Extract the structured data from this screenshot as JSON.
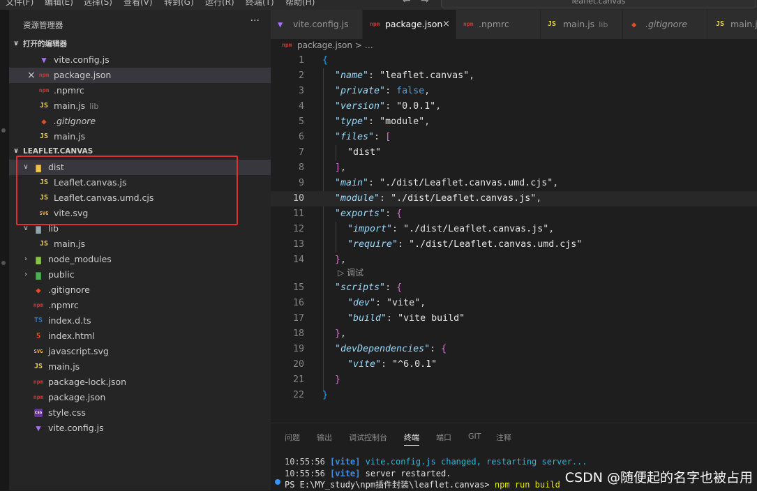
{
  "menubar": {
    "items": [
      "文件(F)",
      "编辑(E)",
      "选择(S)",
      "查看(V)",
      "转到(G)",
      "运行(R)",
      "终端(T)",
      "帮助(H)"
    ],
    "back_arrow": "←",
    "forward_arrow": "→",
    "command_center": "leaflet.canvas"
  },
  "sidebar": {
    "title": "资源管理器",
    "more": "···",
    "open_editors": {
      "header": "打开的编辑器",
      "items": [
        {
          "icon": "vite-icon",
          "glyph": "▼",
          "label": "vite.config.js",
          "detail": ""
        },
        {
          "icon": "npm-icon",
          "glyph": "npm",
          "label": "package.json",
          "detail": "",
          "close": "×"
        },
        {
          "icon": "npm-icon",
          "glyph": "npm",
          "label": ".npmrc",
          "detail": ""
        },
        {
          "icon": "js-icon",
          "glyph": "JS",
          "label": "main.js",
          "detail": "lib"
        },
        {
          "icon": "git-icon",
          "glyph": "◆",
          "label": ".gitignore",
          "detail": ""
        },
        {
          "icon": "js-icon",
          "glyph": "JS",
          "label": "main.js",
          "detail": ""
        }
      ]
    },
    "project": {
      "header": "LEAFLET.CANVAS",
      "items": [
        {
          "type": "folder",
          "label": "dist",
          "glyph": "▆"
        },
        {
          "type": "file",
          "glyph": "JS",
          "label": "Leaflet.canvas.js"
        },
        {
          "type": "file",
          "glyph": "JS",
          "label": "Leaflet.canvas.umd.cjs"
        },
        {
          "type": "file",
          "glyph": "SVG",
          "label": "vite.svg"
        },
        {
          "type": "folder",
          "label": "lib",
          "glyph": "▆"
        },
        {
          "type": "file",
          "glyph": "JS",
          "label": "main.js"
        },
        {
          "type": "folder",
          "label": "node_modules",
          "glyph": "▆"
        },
        {
          "type": "folder",
          "label": "public",
          "glyph": "▆"
        },
        {
          "type": "file",
          "glyph": "◆",
          "label": ".gitignore"
        },
        {
          "type": "file",
          "glyph": "npm",
          "label": ".npmrc"
        },
        {
          "type": "file",
          "glyph": "TS",
          "label": "index.d.ts"
        },
        {
          "type": "file",
          "glyph": "5",
          "label": "index.html"
        },
        {
          "type": "file",
          "glyph": "SVG",
          "label": "javascript.svg"
        },
        {
          "type": "file",
          "glyph": "JS",
          "label": "main.js"
        },
        {
          "type": "file",
          "glyph": "npm",
          "label": "package-lock.json"
        },
        {
          "type": "file",
          "glyph": "npm",
          "label": "package.json"
        },
        {
          "type": "file",
          "glyph": "css",
          "label": "style.css"
        },
        {
          "type": "file",
          "glyph": "▼",
          "label": "vite.config.js"
        }
      ]
    }
  },
  "tabs": [
    {
      "glyph": "▼",
      "label": "vite.config.js",
      "detail": ""
    },
    {
      "glyph": "npm",
      "label": "package.json",
      "detail": "",
      "close": "×"
    },
    {
      "glyph": "npm",
      "label": ".npmrc",
      "detail": ""
    },
    {
      "glyph": "JS",
      "label": "main.js",
      "detail": "lib"
    },
    {
      "glyph": "◆",
      "label": ".gitignore",
      "detail": ""
    },
    {
      "glyph": "JS",
      "label": "main.js",
      "detail": ""
    }
  ],
  "breadcrumb": {
    "glyph": "npm",
    "text": "package.json > …"
  },
  "editor": {
    "line_numbers": [
      "1",
      "2",
      "3",
      "4",
      "5",
      "6",
      "7",
      "8",
      "9",
      "10",
      "11",
      "12",
      "13",
      "14",
      "15",
      "16",
      "17",
      "18",
      "19",
      "20",
      "21",
      "22"
    ],
    "codelens": "▷ 调试"
  },
  "panel": {
    "tabs": [
      "问题",
      "输出",
      "调试控制台",
      "终端",
      "端口",
      "GIT",
      "注释"
    ],
    "terminal": {
      "line1_time": "10:55:56",
      "line1_tag": "[vite]",
      "line1_msg": "vite.config.js changed, restarting server...",
      "line2_time": "10:55:56",
      "line2_tag": "[vite]",
      "line2_msg": "server restarted.",
      "prompt": "PS E:\\MY_study\\npm插件封装\\leaflet.canvas>",
      "command": "npm run build"
    }
  },
  "watermark": "CSDN @随便起的名字也被占用"
}
